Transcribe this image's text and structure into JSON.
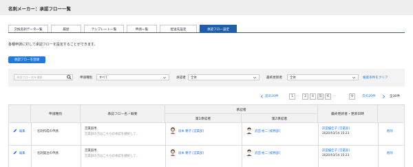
{
  "header": {
    "title": "名刺メーカー：承認フロー一覧"
  },
  "tabs": [
    {
      "label": "交換名刺データ一覧"
    },
    {
      "label": "履歴"
    },
    {
      "label": "テンプレート一覧"
    },
    {
      "label": "申請一覧"
    },
    {
      "label": "配送先設定"
    },
    {
      "label": "承認フロー設定"
    }
  ],
  "description": "各種申請に対して承認フローを設定することができます。",
  "register_button": "承認フローを登録",
  "filters": {
    "search_placeholder": "承認フロー名を検索",
    "request_type_label": "申請種別",
    "request_type_value": "すべて",
    "approver_label": "承認者",
    "approver_value": "全体",
    "updater_label": "最終更新者",
    "updater_value": "全体",
    "clear_label": "検索条件をクリア"
  },
  "pagination": {
    "prev": "前の20件",
    "first": "1",
    "ellipsis": "…",
    "pages": [
      "3",
      "4",
      "5",
      "6"
    ],
    "active_page": "5",
    "last": "9",
    "next": "次の20件",
    "total": "全30件"
  },
  "table": {
    "headers": {
      "request_type": "申請種別",
      "flow_name": "承認フロー名・概要",
      "approver": "承認者",
      "approver1": "第1承認者",
      "approver2": "第2承認者",
      "last_updated": "最終更新者・更新日時"
    },
    "rows": [
      {
        "edit": "編集",
        "request_type": "名刺作成の申請",
        "flow_name": "営業部用",
        "flow_desc": "営業部の方はこちらの承認を選択して…",
        "approver1": "坂本 穂子 [営業部]",
        "approver2": "武田 裕二 [総務部]",
        "updater": "前田優佳子 [営業部]",
        "updated_at": "2020/03/14 15:23",
        "delete": "削除"
      },
      {
        "edit": "編集",
        "request_type": "名刺発注の申請",
        "flow_name": "営業部用",
        "flow_desc": "営業部の方はこちらの承認を選択して…",
        "approver1": "坂本 穂子 [営業部]",
        "approver2": "武田 裕二 [総務部]",
        "updater": "前田優佳子 [営業部]",
        "updated_at": "2020/03/14 15:23",
        "delete": "削除"
      }
    ]
  },
  "colors": {
    "accent": "#1f7ae0",
    "tab_active": "#1f5fa8",
    "header_bg": "#eeeeee"
  }
}
